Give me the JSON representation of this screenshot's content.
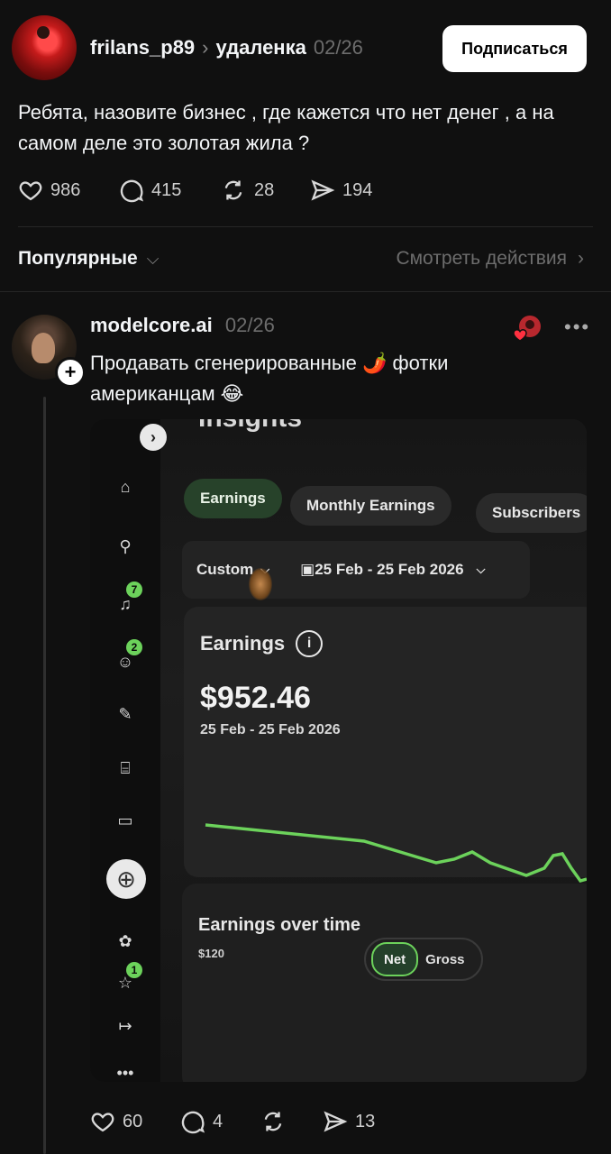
{
  "post": {
    "username": "frilans_p89",
    "community": "удаленка",
    "date": "02/26",
    "subscribe_label": "Подписаться",
    "text": "Ребята, назовите бизнес , где кажется что нет денег , а на самом деле это золотая жила ?",
    "likes": "986",
    "comments": "415",
    "reposts": "28",
    "shares": "194"
  },
  "sort": {
    "label": "Популярные",
    "view_activity": "Смотреть действия"
  },
  "reply": {
    "username": "modelcore.ai",
    "date": "02/26",
    "text": "Продавать сгенерированные 🌶️ фотки американцам 😂",
    "likes": "60",
    "comments": "4",
    "reposts": "",
    "shares": "13"
  },
  "photo": {
    "heading": "Insights",
    "chips": [
      "Earnings",
      "Monthly Earnings",
      "Subscribers"
    ],
    "filter_mode": "Custom",
    "date_range": "25 Feb - 25 Feb 2026",
    "card_title": "Earnings",
    "amount": "$952.46",
    "amount_range": "25 Feb - 25 Feb 2026",
    "over_time_title": "Earnings over time",
    "axis_value": "$120",
    "toggle_net": "Net",
    "toggle_gross": "Gross",
    "badges": {
      "notifications": "7",
      "messages": "2",
      "favorites": "1"
    },
    "line_color": "#6cd25b"
  }
}
